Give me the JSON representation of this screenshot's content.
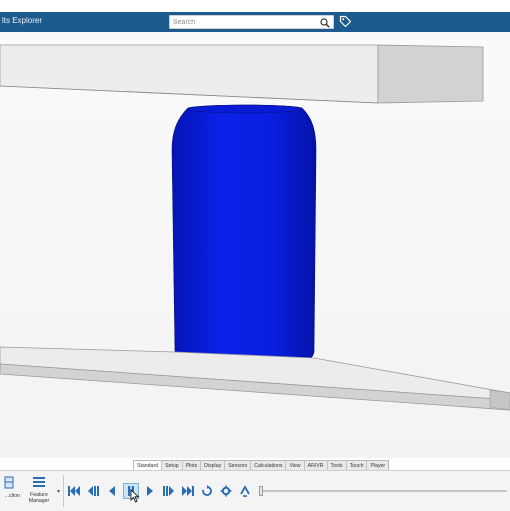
{
  "titlebar": {
    "title": "lts Explorer",
    "search_placeholder": "Search",
    "icons": [
      "search-icon",
      "tag-icon"
    ]
  },
  "viewport": {
    "scene": "can-crush-simulation",
    "colors": {
      "can": "#0c1fe6",
      "platen_face": "#eeeeee",
      "platen_side": "#cfcfcf",
      "background": "#f7f7f7"
    }
  },
  "command_tabs": [
    {
      "label": "Standard",
      "active": true
    },
    {
      "label": "Setup",
      "active": false
    },
    {
      "label": "Plots",
      "active": false
    },
    {
      "label": "Display",
      "active": false
    },
    {
      "label": "Sensors",
      "active": false
    },
    {
      "label": "Calculations",
      "active": false
    },
    {
      "label": "View",
      "active": false
    },
    {
      "label": "AR/VR",
      "active": false
    },
    {
      "label": "Tools",
      "active": false
    },
    {
      "label": "Touch",
      "active": false
    },
    {
      "label": "Player",
      "active": false
    }
  ],
  "cmdbar": {
    "left_button_label": "...ction",
    "feature_manager_label": "Feature Manager",
    "player_buttons": [
      "first-frame-icon",
      "step-back-icon",
      "play-reverse-icon",
      "pause-icon",
      "play-icon",
      "step-forward-icon",
      "last-frame-icon",
      "loop-icon",
      "settings-icon",
      "reverse-icon"
    ],
    "active_button": "pause-icon",
    "timeline_position": 0.0,
    "accent": "#2a6db5"
  }
}
